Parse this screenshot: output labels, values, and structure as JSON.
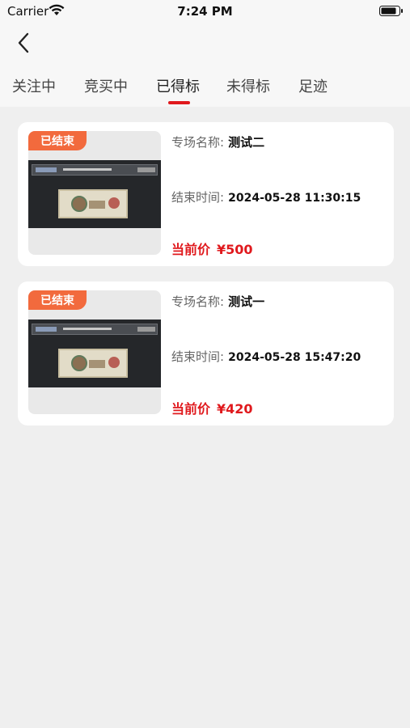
{
  "status_bar": {
    "carrier": "Carrier",
    "time": "7:24 PM"
  },
  "nav": {
    "back_icon": "chevron-left-icon"
  },
  "tabs": [
    {
      "label": "关注中",
      "active": false
    },
    {
      "label": "竞买中",
      "active": false
    },
    {
      "label": "已得标",
      "active": true
    },
    {
      "label": "未得标",
      "active": false
    },
    {
      "label": "足迹",
      "active": false
    }
  ],
  "colors": {
    "accent": "#e0191d",
    "badge": "#f26a3d",
    "background": "#efefef"
  },
  "items": [
    {
      "badge": "已结束",
      "session_label": "专场名称:",
      "session_name": "测试二",
      "end_label": "结束时间:",
      "end_time": "2024-05-28 11:30:15",
      "price_label": "当前价",
      "price": "¥500"
    },
    {
      "badge": "已结束",
      "session_label": "专场名称:",
      "session_name": "测试一",
      "end_label": "结束时间:",
      "end_time": "2024-05-28 15:47:20",
      "price_label": "当前价",
      "price": "¥420"
    }
  ]
}
